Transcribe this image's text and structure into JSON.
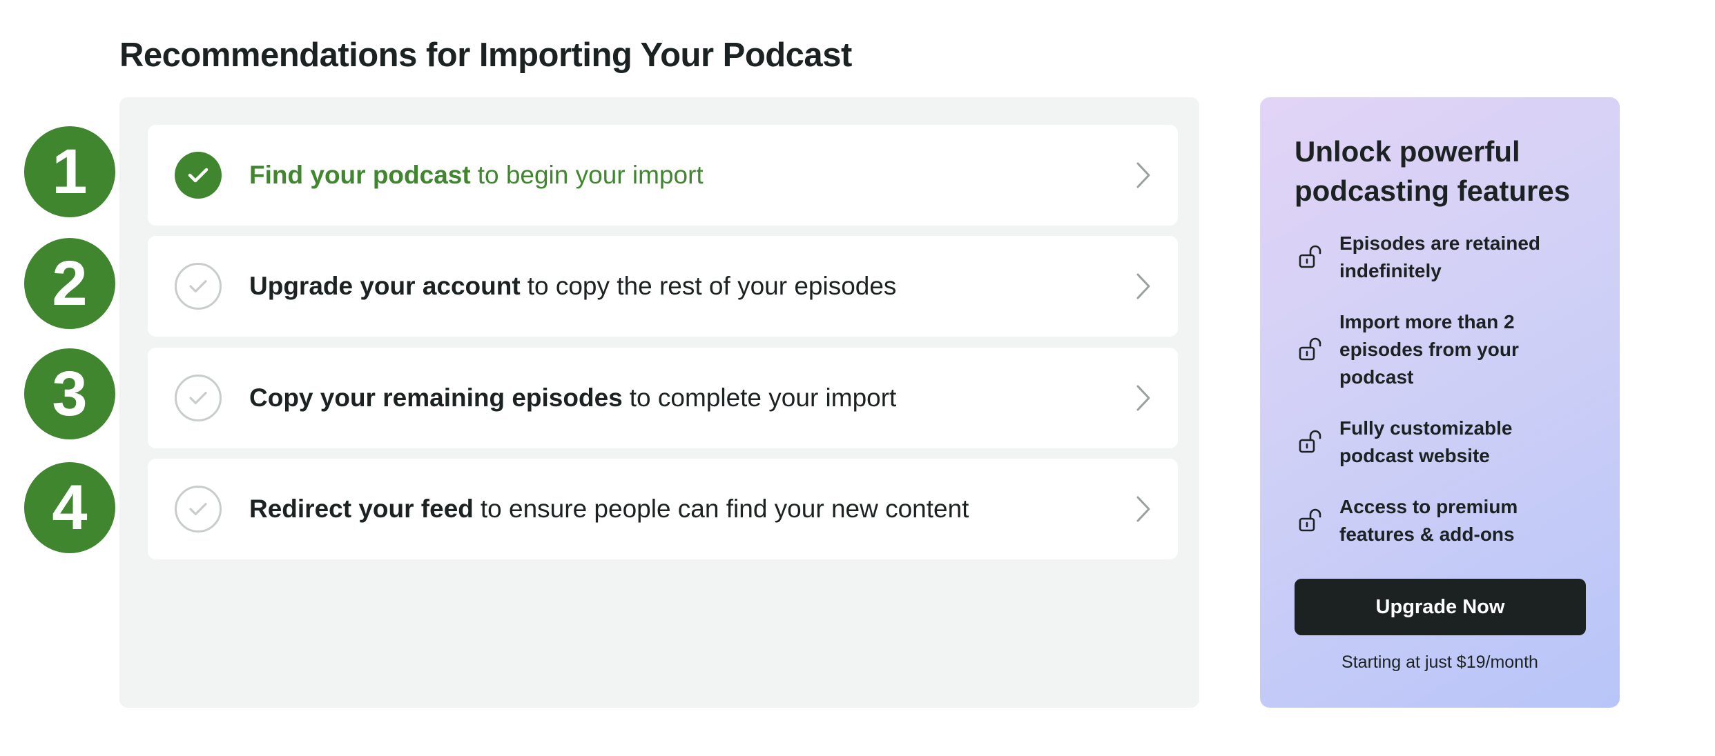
{
  "page": {
    "title": "Recommendations for Importing Your Podcast"
  },
  "steps": [
    {
      "number": "1",
      "bold": "Find your podcast",
      "rest": "to begin your import",
      "completed": true
    },
    {
      "number": "2",
      "bold": "Upgrade your account",
      "rest": "to copy the rest of your episodes",
      "completed": false
    },
    {
      "number": "3",
      "bold": "Copy your remaining episodes",
      "rest": "to complete your import",
      "completed": false
    },
    {
      "number": "4",
      "bold": "Redirect your feed",
      "rest": "to ensure people can find your new content",
      "completed": false
    }
  ],
  "upgrade_card": {
    "title": "Unlock powerful podcasting features",
    "features": [
      {
        "icon": "unlock-icon",
        "text": "Episodes are retained indefinitely"
      },
      {
        "icon": "unlock-icon",
        "text": "Import more than 2 episodes from your podcast"
      },
      {
        "icon": "unlock-icon",
        "text": "Fully customizable podcast website"
      },
      {
        "icon": "unlock-icon",
        "text": "Access to premium features & add-ons"
      }
    ],
    "button_label": "Upgrade Now",
    "price_note": "Starting at just $19/month"
  },
  "colors": {
    "accent_green": "#3f862f",
    "panel_bg": "#f2f4f3",
    "button_dark": "#1c2222",
    "card_gradient_start": "#e2d4f6",
    "card_gradient_end": "#b8c5f8"
  }
}
